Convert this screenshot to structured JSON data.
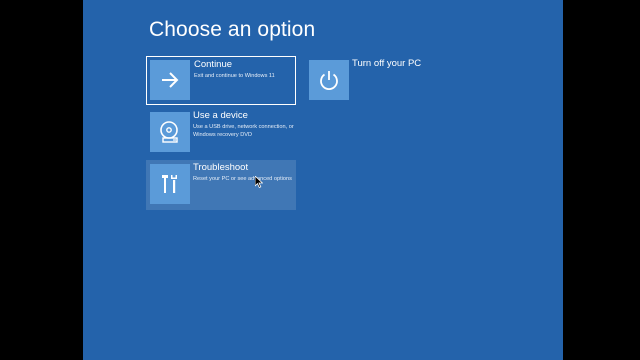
{
  "screen": {
    "title": "Choose an option",
    "background": "#2463ab",
    "tile_color": "#5b9bd9"
  },
  "options": [
    {
      "id": "continue",
      "icon": "arrow-right-icon",
      "name": "Continue",
      "description": "Exit and continue to Windows 11",
      "focused": true
    },
    {
      "id": "use-device",
      "icon": "disc-drive-icon",
      "name": "Use a device",
      "description": "Use a USB drive, network connection, or Windows recovery DVD"
    },
    {
      "id": "troubleshoot",
      "icon": "tools-icon",
      "name": "Troubleshoot",
      "description": "Reset your PC or see advanced options",
      "hovered": true
    },
    {
      "id": "turn-off",
      "icon": "power-icon",
      "name": "Turn off your PC",
      "description": ""
    }
  ]
}
